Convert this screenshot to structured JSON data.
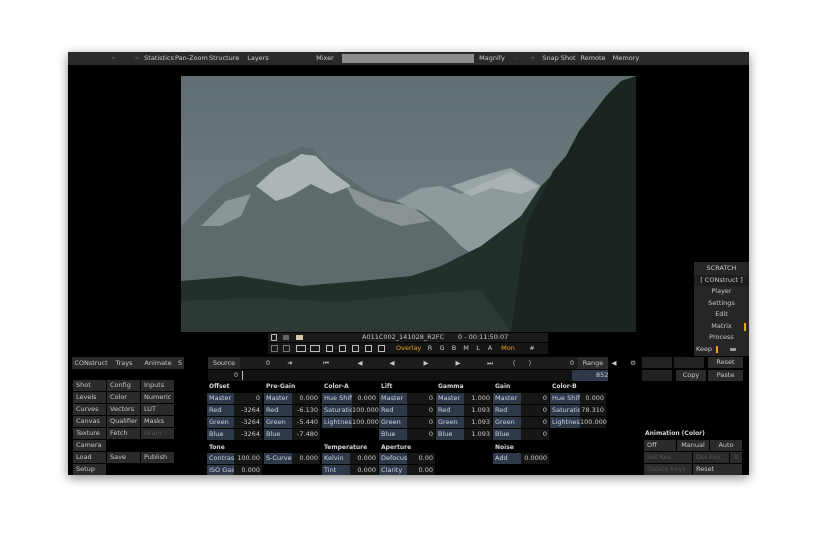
{
  "topbar": {
    "back_label": "←",
    "fwd_label": "→",
    "items": [
      "Statistics",
      "Pan-Zoom",
      "Structure",
      "Layers",
      "Mixer"
    ],
    "magnify": "Magnify",
    "minus": "–",
    "plus": "+",
    "right_items": [
      "Snap Shot",
      "Remote",
      "Memory"
    ]
  },
  "viewer": {
    "clip_name": "A011C002_141028_R2FC",
    "timecode": "0 - 00:11:50:07"
  },
  "viewer_controls": {
    "overlay": "Overlay",
    "channels": [
      "R",
      "G",
      "B",
      "M",
      "L",
      "A"
    ],
    "mon": "Mon"
  },
  "side_menu": {
    "title": "SCRATCH",
    "items": [
      "[ CONstruct ]",
      "Player",
      "Settings",
      "Edit",
      "Matrix",
      "Process"
    ],
    "keep": "Keep"
  },
  "transport": {
    "tabs": [
      "CONstruct",
      "Trays",
      "Animate",
      "S"
    ],
    "source": "Source",
    "frame_left": "0",
    "frame_right": "0",
    "range": "Range",
    "reset": "Reset",
    "timeline_start": "0",
    "timeline_end": "852",
    "copy": "Copy",
    "paste": "Paste"
  },
  "left_menu": [
    [
      "Shot",
      "Config",
      "Inputs"
    ],
    [
      "Levels",
      "Color",
      "Numeric"
    ],
    [
      "Curves",
      "Vectors",
      "LUT"
    ],
    [
      "Canvas",
      "Qualifier",
      "Masks"
    ],
    [
      "Texture",
      "Fetch",
      "Grain"
    ],
    [
      "Camera",
      "",
      ""
    ],
    [
      "Load",
      "Save",
      "Publish"
    ],
    [
      "Setup",
      "",
      ""
    ]
  ],
  "groups": {
    "offset": {
      "title": "Offset",
      "rows": [
        [
          "Master",
          "0"
        ],
        [
          "Red",
          "-3264"
        ],
        [
          "Green",
          "-3264"
        ],
        [
          "Blue",
          "-3264"
        ]
      ]
    },
    "pregain": {
      "title": "Pre-Gain",
      "rows": [
        [
          "Master",
          "0.000"
        ],
        [
          "Red",
          "-6.130"
        ],
        [
          "Green",
          "-5.440"
        ],
        [
          "Blue",
          "-7.480"
        ]
      ]
    },
    "colora": {
      "title": "Color-A",
      "rows": [
        [
          "Hue Shift",
          "0.000"
        ],
        [
          "Saturation",
          "100.000"
        ],
        [
          "Lightness",
          "100.000"
        ]
      ]
    },
    "lift": {
      "title": "Lift",
      "rows": [
        [
          "Master",
          "0"
        ],
        [
          "Red",
          "0"
        ],
        [
          "Green",
          "0"
        ],
        [
          "Blue",
          "0"
        ]
      ]
    },
    "gamma": {
      "title": "Gamma",
      "rows": [
        [
          "Master",
          "1.000"
        ],
        [
          "Red",
          "1.093"
        ],
        [
          "Green",
          "1.093"
        ],
        [
          "Blue",
          "1.093"
        ]
      ]
    },
    "gain": {
      "title": "Gain",
      "rows": [
        [
          "Master",
          "0"
        ],
        [
          "Red",
          "0"
        ],
        [
          "Green",
          "0"
        ],
        [
          "Blue",
          "0"
        ]
      ]
    },
    "colorb": {
      "title": "Color-B",
      "rows": [
        [
          "Hue Shift",
          "0.000"
        ],
        [
          "Saturation",
          "78.310"
        ],
        [
          "Lightness",
          "100.000"
        ]
      ]
    },
    "tone": {
      "title": "Tone",
      "rows": [
        [
          "Contrast",
          "100.00"
        ],
        [
          "ISO Gain",
          "0.000"
        ]
      ]
    },
    "scurve": {
      "title": "",
      "rows": [
        [
          "S-Curve",
          "0.000"
        ]
      ]
    },
    "temperature": {
      "title": "Temperature",
      "rows": [
        [
          "Kelvin",
          "0.000"
        ],
        [
          "Tint",
          "0.000"
        ]
      ]
    },
    "aperture": {
      "title": "Aperture",
      "rows": [
        [
          "Defocus",
          "0.00"
        ],
        [
          "Clarity",
          "0.00"
        ]
      ]
    },
    "noise": {
      "title": "Noise",
      "rows": [
        [
          "Add",
          "0.0000"
        ]
      ]
    }
  },
  "animation": {
    "title": "Animation (Color)",
    "modes": [
      "Off",
      "Manual",
      "Auto"
    ],
    "set_key": "Set Key",
    "del_key": "Del Key",
    "delete_keys": "Delete Keys",
    "reset": "Reset",
    "x": "X"
  },
  "colors": {
    "accent": "#e8a21f",
    "field": "#2e3a4a",
    "panel": "#2b2b2b",
    "app_bg": "#000000"
  }
}
